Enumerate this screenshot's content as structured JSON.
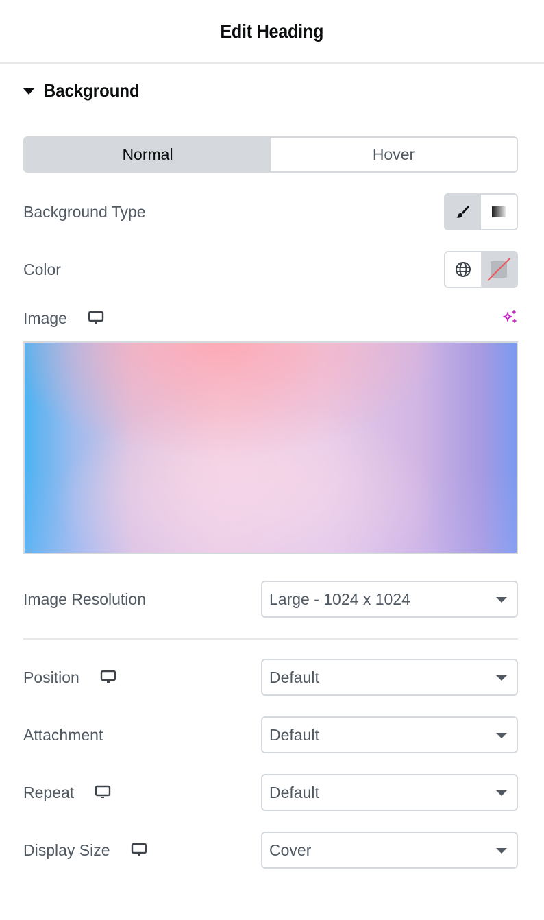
{
  "header": {
    "title": "Edit Heading"
  },
  "section": {
    "title": "Background",
    "expanded": true
  },
  "tabs": [
    {
      "label": "Normal",
      "active": true
    },
    {
      "label": "Hover",
      "active": false
    }
  ],
  "controls": {
    "background_type": {
      "label": "Background Type",
      "options": [
        "classic-brush-icon",
        "gradient-icon"
      ],
      "selected": "classic"
    },
    "color": {
      "label": "Color",
      "options": [
        "global-colors-icon",
        "no-color-swatch"
      ],
      "selected": "none"
    },
    "image": {
      "label": "Image",
      "responsive": true,
      "ai_button": "ai-sparkle-icon"
    },
    "image_resolution": {
      "label": "Image Resolution",
      "value": "Large - 1024 x 1024"
    },
    "position": {
      "label": "Position",
      "responsive": true,
      "value": "Default"
    },
    "attachment": {
      "label": "Attachment",
      "value": "Default"
    },
    "repeat": {
      "label": "Repeat",
      "responsive": true,
      "value": "Default"
    },
    "display_size": {
      "label": "Display Size",
      "responsive": true,
      "value": "Cover"
    }
  },
  "colors": {
    "accent_ai": "#c728c7",
    "active_tab": "#d5d8dc",
    "border": "#d5d8dc",
    "text": "#515962",
    "heading": "#0c0d0e",
    "no_color_slash": "#f0545a"
  }
}
